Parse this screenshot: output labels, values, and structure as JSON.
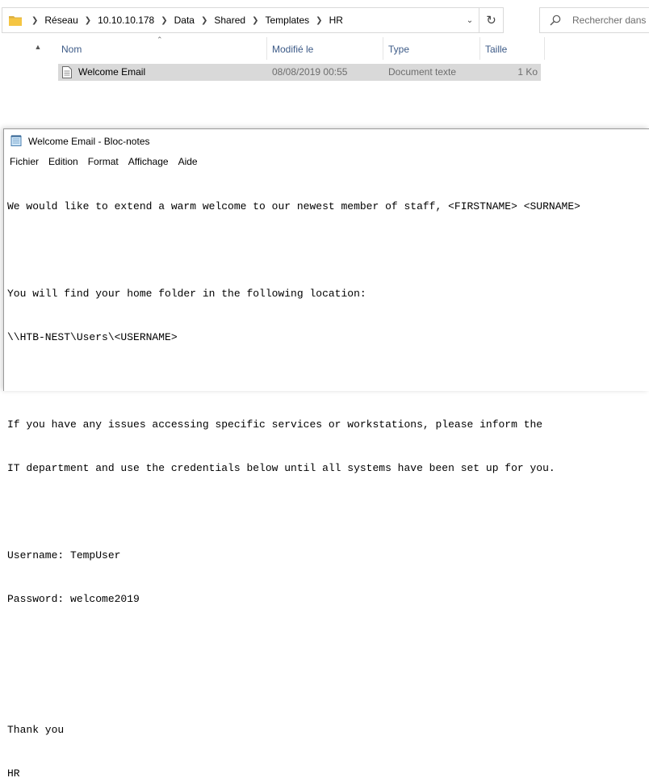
{
  "explorer": {
    "breadcrumb": [
      "Réseau",
      "10.10.10.178",
      "Data",
      "Shared",
      "Templates",
      "HR"
    ],
    "search_placeholder": "Rechercher dans :",
    "columns": {
      "name": "Nom",
      "modified": "Modifié le",
      "type": "Type",
      "size": "Taille"
    },
    "files": [
      {
        "name": "Welcome Email",
        "modified": "08/08/2019 00:55",
        "type": "Document texte",
        "size": "1 Ko"
      }
    ]
  },
  "notepad": {
    "title": "Welcome Email - Bloc-notes",
    "menu": [
      "Fichier",
      "Edition",
      "Format",
      "Affichage",
      "Aide"
    ],
    "lines": [
      "We would like to extend a warm welcome to our newest member of staff, <FIRSTNAME> <SURNAME>",
      "",
      "You will find your home folder in the following location:",
      "\\\\HTB-NEST\\Users\\<USERNAME>",
      "",
      "If you have any issues accessing specific services or workstations, please inform the",
      "IT department and use the credentials below until all systems have been set up for you.",
      "",
      "Username: TempUser",
      "Password: welcome2019",
      "",
      "",
      "Thank you",
      "HR"
    ]
  },
  "colors": {
    "selected_row": "#d9d9d9",
    "column_header_text": "#3c5a87",
    "folder_yellow": "#f5c542"
  }
}
